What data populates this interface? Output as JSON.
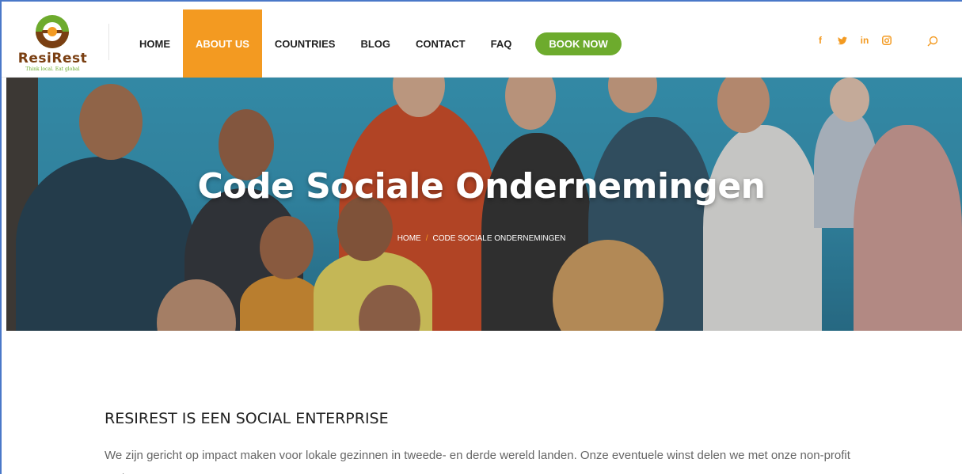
{
  "brand": {
    "name": "ResiRest",
    "tagline": "Think local. Eat global",
    "colors": {
      "orange": "#f39a21",
      "green": "#6dab2d",
      "brown": "#7a3f12"
    }
  },
  "nav": {
    "items": [
      {
        "label": "HOME",
        "active": false
      },
      {
        "label": "ABOUT US",
        "active": true
      },
      {
        "label": "COUNTRIES",
        "active": false
      },
      {
        "label": "BLOG",
        "active": false
      },
      {
        "label": "CONTACT",
        "active": false
      },
      {
        "label": "FAQ",
        "active": false
      }
    ],
    "cta_label": "BOOK NOW"
  },
  "social": {
    "facebook": "f",
    "twitter": "t",
    "linkedin": "in",
    "instagram_icon": "instagram-icon"
  },
  "hero": {
    "title": "Code Sociale Ondernemingen",
    "breadcrumb": {
      "home": "HOME",
      "separator": "/",
      "current": "CODE SOCIALE ONDERNEMINGEN"
    }
  },
  "content": {
    "heading": "RESIREST IS EEN SOCIAL ENTERPRISE",
    "paragraph": "We zijn gericht op impact maken voor lokale gezinnen in tweede- en derde wereld landen. Onze eventuele winst delen we met onze non-profit partners."
  }
}
